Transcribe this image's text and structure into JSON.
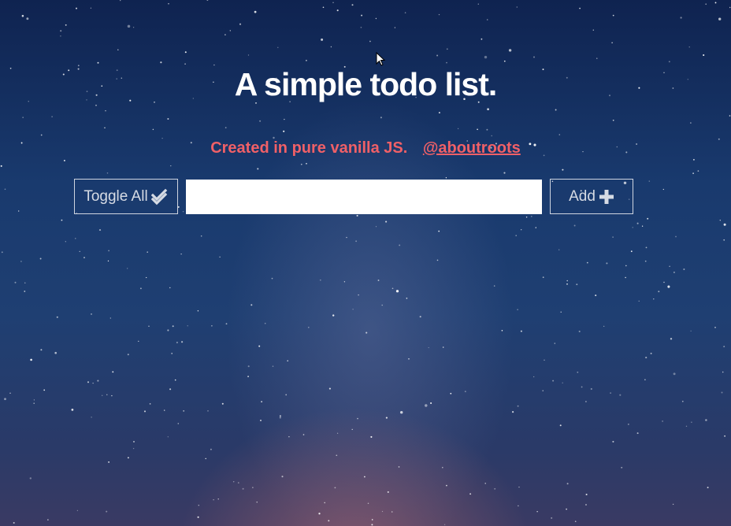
{
  "header": {
    "title": "A simple todo list.",
    "credit_text": "Created in pure vanilla JS.",
    "credit_link": "@aboutroots"
  },
  "controls": {
    "toggle_all_label": "Toggle All",
    "toggle_all_icon": "double-check-icon",
    "todo_input_value": "",
    "todo_input_placeholder": "",
    "add_label": "Add",
    "add_icon": "plus-icon"
  },
  "theme": {
    "accent": "#f06067",
    "text": "#ffffff",
    "button_text": "#d6dbe4",
    "background": "#1a3568"
  }
}
